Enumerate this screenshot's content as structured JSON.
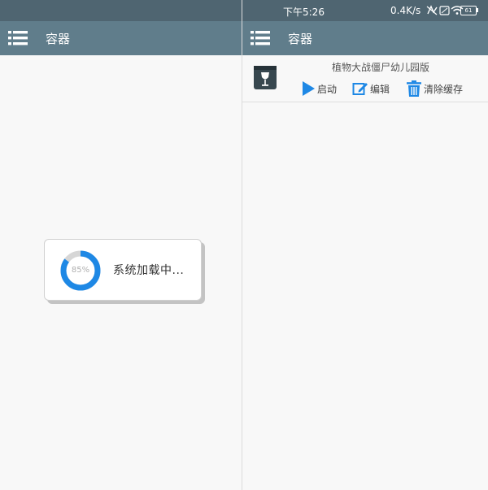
{
  "left_screen": {
    "appbar": {
      "title": "容器",
      "menu_icon": "menu-list-icon"
    },
    "loading_dialog": {
      "progress_label": "85%",
      "progress_fraction": 0.85,
      "message": "系统加载中..."
    }
  },
  "right_screen": {
    "statusbar": {
      "time": "下午5:26",
      "network_speed": "0.4K/s",
      "battery": "61"
    },
    "appbar": {
      "title": "容器",
      "menu_icon": "menu-list-icon"
    },
    "container_item": {
      "name": "植物大战僵尸幼儿园版",
      "icon": "wine-glass-box-icon",
      "actions": [
        {
          "label": "启动",
          "icon": "play-icon"
        },
        {
          "label": "编辑",
          "icon": "edit-icon"
        },
        {
          "label": "清除缓存",
          "icon": "trash-icon"
        }
      ]
    }
  },
  "colors": {
    "statusbar": "#4f6571",
    "appbar": "#607d8b",
    "accent_blue": "#1e88e5",
    "progress_track": "#d6d6d6"
  }
}
